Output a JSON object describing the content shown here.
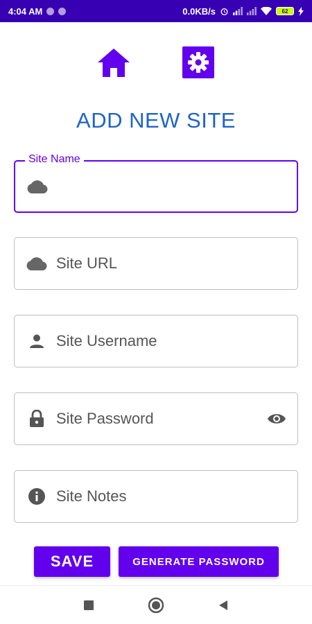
{
  "status_bar": {
    "time": "4:04 AM",
    "network_speed": "0.0KB/s",
    "battery": "62"
  },
  "top_nav": {
    "home_icon": "home-icon",
    "settings_icon": "settings-icon"
  },
  "page": {
    "title": "ADD NEW SITE"
  },
  "form": {
    "site_name": {
      "label": "Site Name",
      "value": "",
      "icon": "cloud-icon"
    },
    "site_url": {
      "placeholder": "Site URL",
      "icon": "cloud-icon"
    },
    "site_username": {
      "placeholder": "Site Username",
      "icon": "person-icon"
    },
    "site_password": {
      "placeholder": "Site Password",
      "icon": "lock-icon",
      "trailing_icon": "eye-icon"
    },
    "site_notes": {
      "placeholder": "Site Notes",
      "icon": "info-icon"
    }
  },
  "buttons": {
    "save_label": "SAVE",
    "generate_label": "GENERATE PASSWORD"
  },
  "colors": {
    "primary": "#6200ee",
    "status_bar": "#3700b3",
    "title": "#1e64c8"
  }
}
